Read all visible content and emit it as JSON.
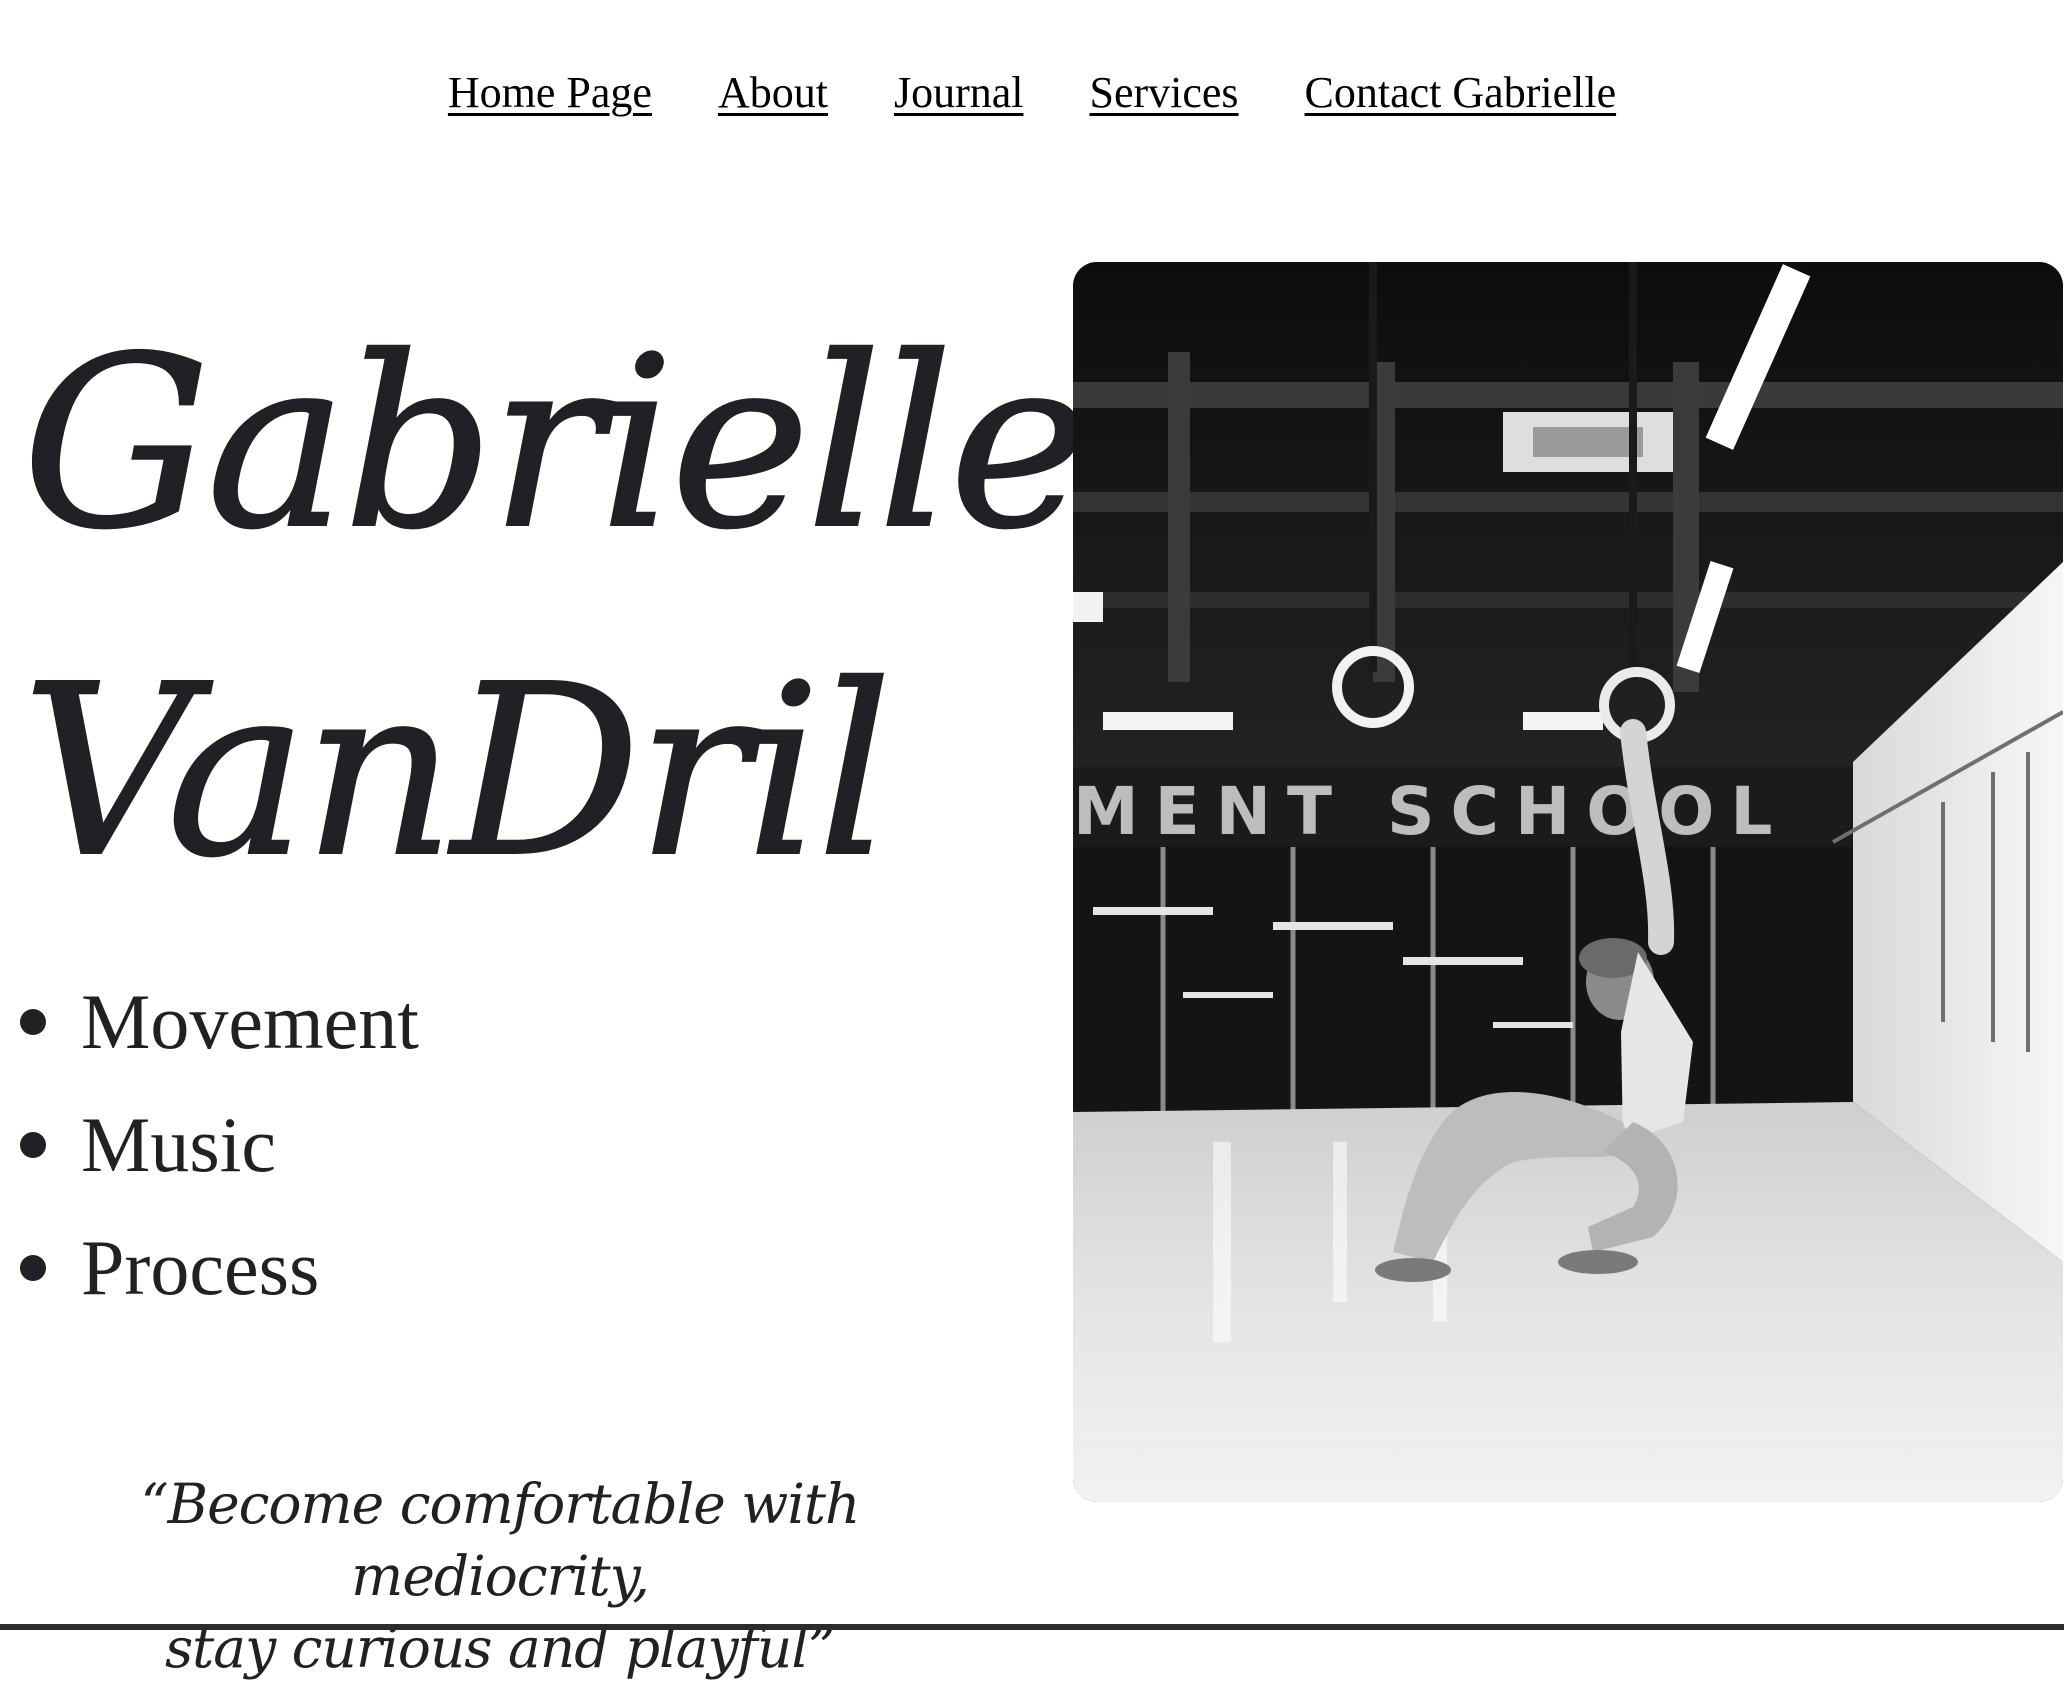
{
  "nav": {
    "items": [
      {
        "label": "Home Page"
      },
      {
        "label": "About"
      },
      {
        "label": "Journal"
      },
      {
        "label": "Services"
      },
      {
        "label": "Contact Gabrielle"
      }
    ]
  },
  "hero": {
    "first_name": "Gabrielle",
    "last_name": "VanDril"
  },
  "tags": [
    "Movement",
    "Music",
    "Process"
  ],
  "quote": {
    "line1": "“Become comfortable with mediocrity,",
    "line2": "stay curious and playful”"
  },
  "photo": {
    "sign_text": "MENT SCHOOL",
    "subject": "dancer-hanging-from-gymnastic-ring"
  },
  "colors": {
    "text": "#1f2124",
    "link": "#000000",
    "background": "#ffffff"
  }
}
